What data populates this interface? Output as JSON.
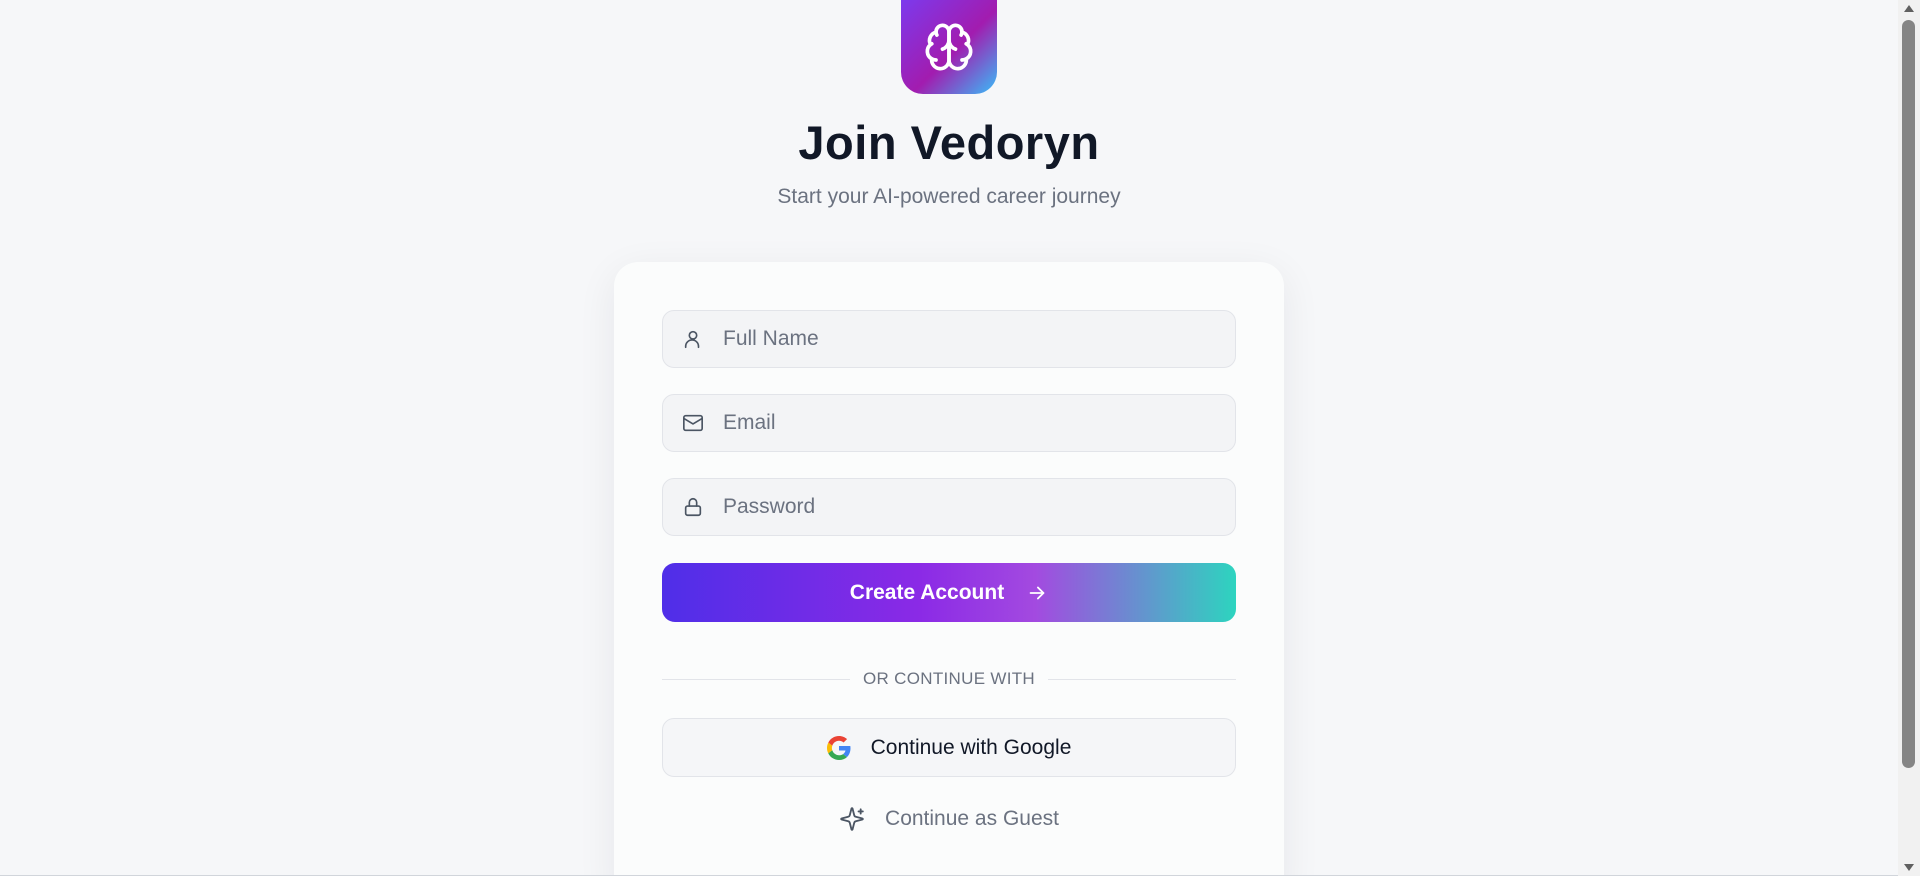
{
  "brand": {
    "logo_icon": "brain-icon",
    "title": "Join Vedoryn",
    "subtitle": "Start your AI-powered career journey"
  },
  "form": {
    "full_name": {
      "placeholder": "Full Name",
      "value": "",
      "icon": "user-icon"
    },
    "email": {
      "placeholder": "Email",
      "value": "",
      "icon": "mail-icon"
    },
    "password": {
      "placeholder": "Password",
      "value": "",
      "icon": "lock-icon"
    },
    "submit_label": "Create Account",
    "submit_icon": "arrow-right-icon"
  },
  "divider_text": "OR CONTINUE WITH",
  "social": {
    "google_label": "Continue with Google",
    "google_icon": "google-icon"
  },
  "guest": {
    "label": "Continue as Guest",
    "icon": "sparkles-icon"
  },
  "colors": {
    "background": "#f6f7f9",
    "title": "#111827",
    "muted": "#6b7280",
    "gradient_start": "#4f2ee8",
    "gradient_mid": "#8b2ae6",
    "gradient_end": "#2dd4bf"
  }
}
